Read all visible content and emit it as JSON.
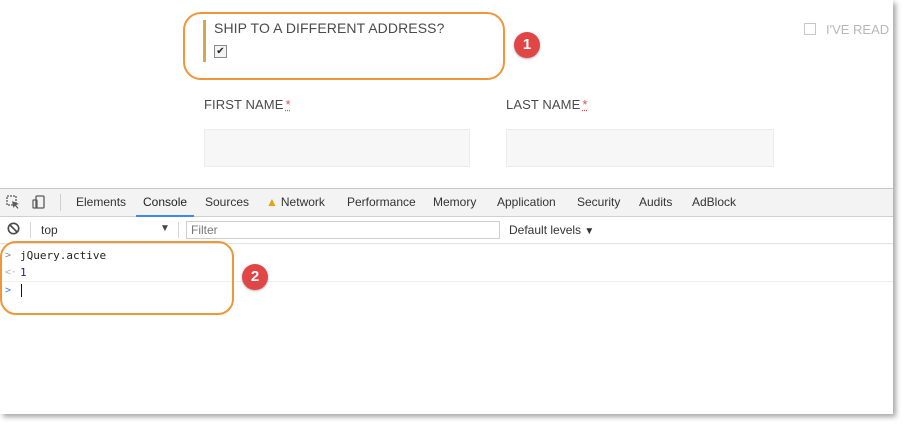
{
  "page": {
    "ship_label": "SHIP TO A DIFFERENT ADDRESS?",
    "ship_checked": true,
    "terms_label": "I'VE READ",
    "first_name_label": "FIRST NAME",
    "last_name_label": "LAST NAME",
    "required_mark": "*",
    "first_name_value": "",
    "last_name_value": ""
  },
  "annotations": {
    "badge_1": "1",
    "badge_2": "2"
  },
  "devtools": {
    "tabs": [
      {
        "label": "Elements"
      },
      {
        "label": "Console"
      },
      {
        "label": "Sources"
      },
      {
        "label": "Network"
      },
      {
        "label": "Performance"
      },
      {
        "label": "Memory"
      },
      {
        "label": "Application"
      },
      {
        "label": "Security"
      },
      {
        "label": "Audits"
      },
      {
        "label": "AdBlock"
      }
    ],
    "active_tab": "Console",
    "network_has_warning": true,
    "context": "top",
    "filter_placeholder": "Filter",
    "levels_label": "Default levels"
  },
  "console": {
    "entries": [
      {
        "type": "input",
        "text": "jQuery.active"
      },
      {
        "type": "result",
        "text": "1"
      }
    ],
    "prompt_value": ""
  },
  "colors": {
    "highlight": "#f0963a",
    "badge": "#e04646",
    "accent_bar": "#d7a54a",
    "devtools_tab_underline": "#4285f4",
    "required": "#d9534f"
  },
  "icons": [
    "inspect-element-icon",
    "device-toolbar-icon",
    "warning-icon",
    "clear-console-icon",
    "dropdown-arrow-icon",
    "prompt-chevron-icon"
  ]
}
